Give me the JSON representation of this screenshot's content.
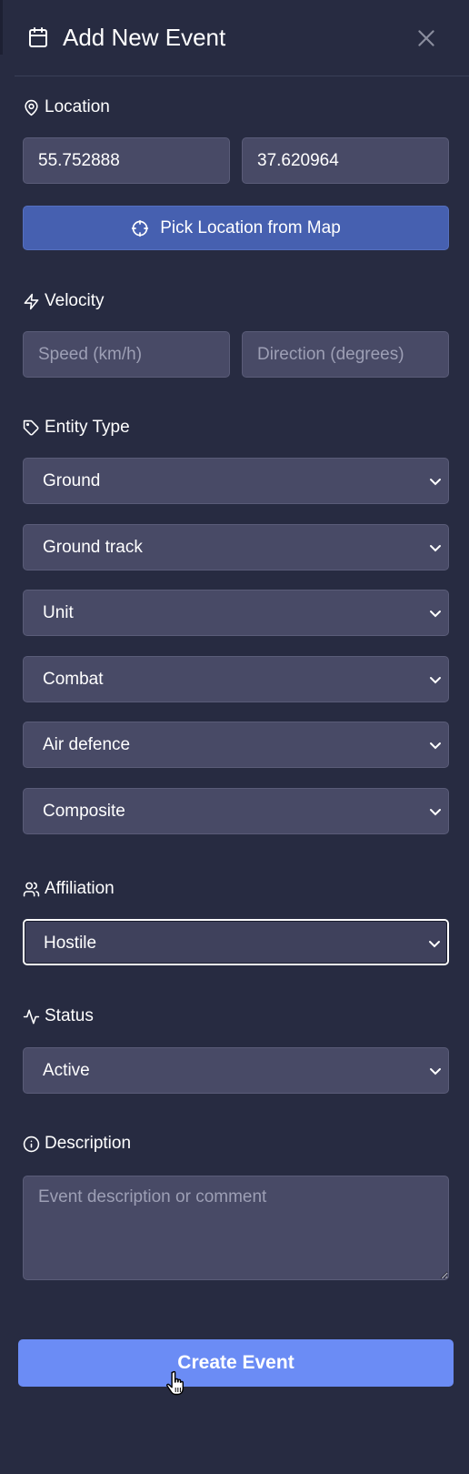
{
  "header": {
    "title": "Add New Event",
    "icon": "calendar-icon",
    "close_icon": "close-icon"
  },
  "location": {
    "label": "Location",
    "icon": "map-pin-icon",
    "latitude": "55.752888",
    "longitude": "37.620964",
    "pick_button": "Pick Location from Map",
    "pick_icon": "crosshair-icon"
  },
  "velocity": {
    "label": "Velocity",
    "icon": "zap-icon",
    "speed_placeholder": "Speed (km/h)",
    "direction_placeholder": "Direction (degrees)"
  },
  "entity_type": {
    "label": "Entity Type",
    "icon": "tag-icon",
    "selects": [
      "Ground",
      "Ground track",
      "Unit",
      "Combat",
      "Air defence",
      "Composite"
    ]
  },
  "affiliation": {
    "label": "Affiliation",
    "icon": "users-icon",
    "value": "Hostile"
  },
  "status": {
    "label": "Status",
    "icon": "activity-icon",
    "value": "Active"
  },
  "description": {
    "label": "Description",
    "icon": "info-icon",
    "placeholder": "Event description or comment"
  },
  "create_button": "Create Event",
  "colors": {
    "background": "#272b41",
    "field": "#484a66",
    "pick_button": "#4660b0",
    "create_button": "#6b8cf5"
  }
}
